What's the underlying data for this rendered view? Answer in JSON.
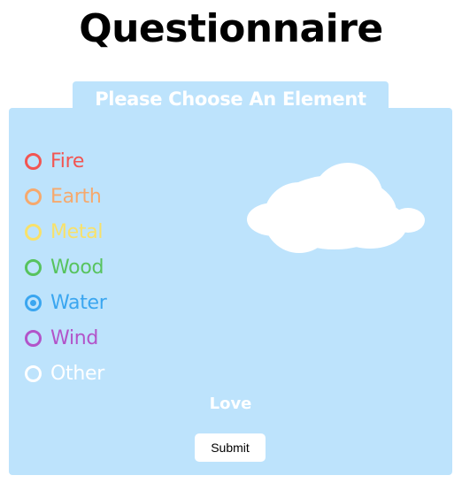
{
  "page": {
    "title": "Questionnaire"
  },
  "form": {
    "heading": "Please Choose An Element",
    "options": [
      {
        "label": "Fire",
        "color": "#f25552",
        "checked": false
      },
      {
        "label": "Earth",
        "color": "#f6a96d",
        "checked": false
      },
      {
        "label": "Metal",
        "color": "#f8e16a",
        "checked": false
      },
      {
        "label": "Wood",
        "color": "#57c35e",
        "checked": false
      },
      {
        "label": "Water",
        "color": "#3aa6f0",
        "checked": true
      },
      {
        "label": "Wind",
        "color": "#b254c9",
        "checked": false
      },
      {
        "label": "Other",
        "color": "#ffffff",
        "checked": false
      }
    ],
    "message": "Love",
    "submit_label": "Submit",
    "decoration_icon": "cloud-icon",
    "panel_color": "#bde3fc"
  }
}
